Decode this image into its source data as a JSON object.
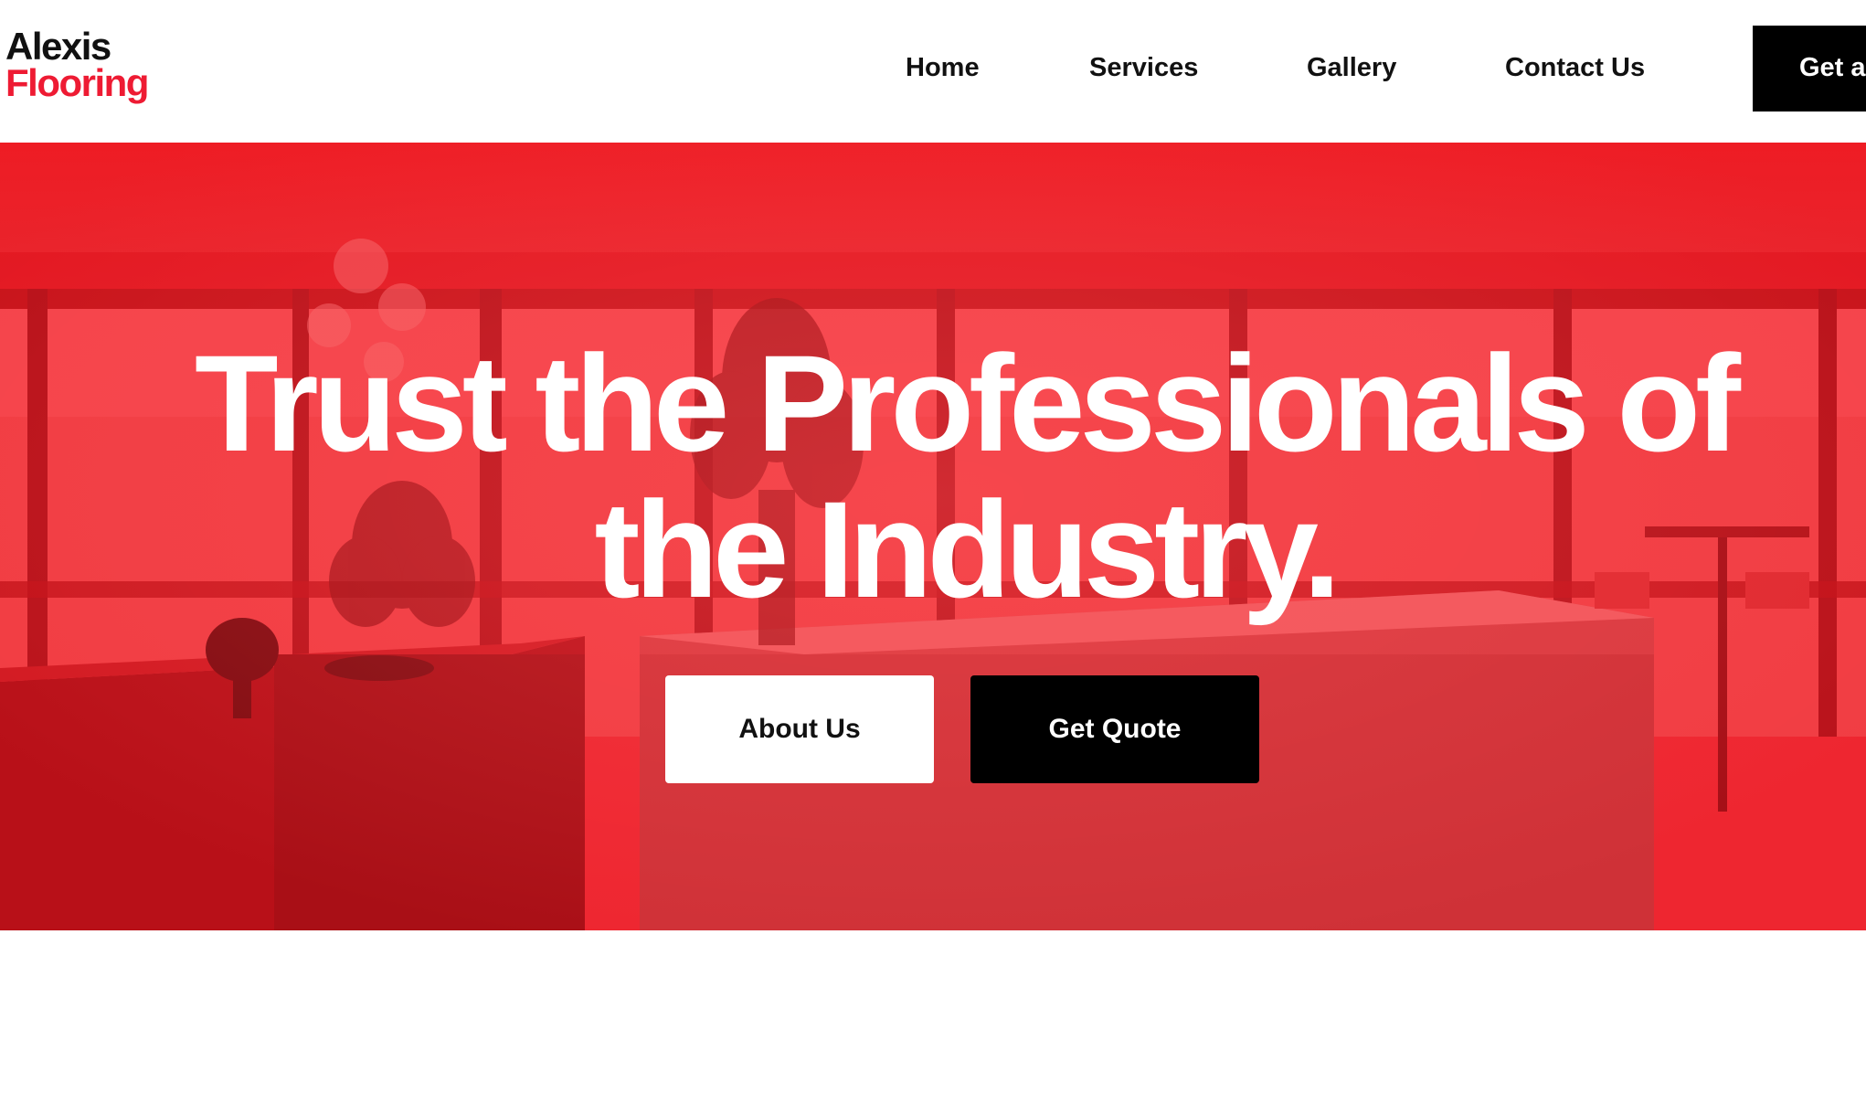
{
  "brand": {
    "name_line1": "Alexis",
    "name_line2": "Flooring",
    "colors": {
      "accent": "#ee1b33",
      "dark": "#111111",
      "hero_overlay": "#ee2630"
    }
  },
  "nav": {
    "items": [
      {
        "label": "Home"
      },
      {
        "label": "Services"
      },
      {
        "label": "Gallery"
      },
      {
        "label": "Contact Us"
      }
    ],
    "cta_label": "Get a"
  },
  "hero": {
    "title_line1": "Trust the Professionals of",
    "title_line2": "the Industry.",
    "primary_button": "About Us",
    "secondary_button": "Get Quote",
    "background": "office-interior-photo-red-overlay"
  }
}
